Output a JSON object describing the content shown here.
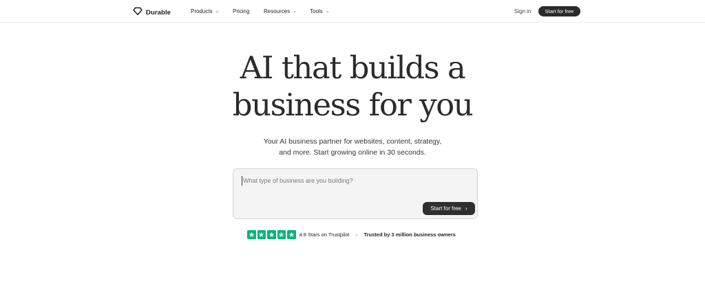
{
  "header": {
    "logo_text": "Durable",
    "nav": [
      {
        "label": "Products",
        "has_dropdown": true
      },
      {
        "label": "Pricing",
        "has_dropdown": false
      },
      {
        "label": "Resources",
        "has_dropdown": true
      },
      {
        "label": "Tools",
        "has_dropdown": true
      }
    ],
    "sign_in": "Sign in",
    "cta": "Start for free"
  },
  "hero": {
    "title_line1": "AI that builds a",
    "title_line2": "business for you",
    "subtitle_line1": "Your AI business partner for websites, content, strategy,",
    "subtitle_line2": "and more. Start growing online in 30 seconds."
  },
  "prompt": {
    "placeholder": "What type of business are you building?",
    "value": "",
    "submit_label": "Start for free",
    "submit_icon": "chevron-right-icon"
  },
  "trust": {
    "stars": 5,
    "rating_text": "4.8 Stars on Trustpilot",
    "trusted_text": "Trusted by 3 million business owners",
    "star_color": "#00b67a"
  },
  "colors": {
    "dark_button": "#2b2b2b",
    "background": "#ffffff",
    "input_background": "#f4f4f4"
  }
}
